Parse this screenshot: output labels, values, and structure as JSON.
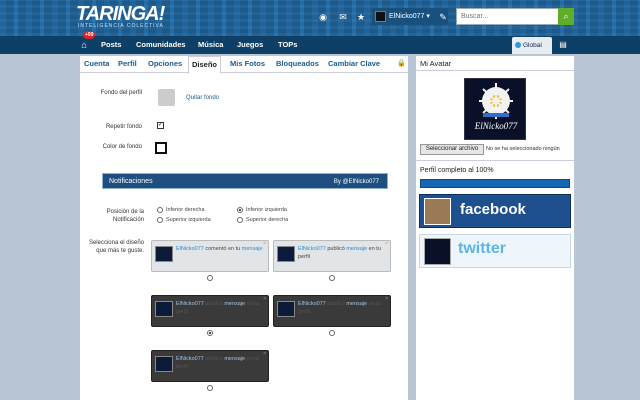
{
  "header": {
    "logo": "TARINGA!",
    "tagline": "INTELIGENCIA COLECTIVA",
    "username": "ElNicko077",
    "search_placeholder": "Buscar...",
    "icons": [
      "eye-icon",
      "mail-icon",
      "star-icon",
      "edit-icon"
    ]
  },
  "nav": {
    "badge": "+99",
    "items": [
      "Posts",
      "Comunidades",
      "Música",
      "Juegos",
      "TOPs"
    ],
    "global_label": "Global"
  },
  "tabs": [
    "Cuenta",
    "Perfil",
    "Opciones",
    "Diseño",
    "Mis Fotos",
    "Bloqueados",
    "Cambiar Clave"
  ],
  "active_tab": "Diseño",
  "design": {
    "bg_label": "Fondo del perfil",
    "remove_bg": "Quitar fondo",
    "repeat_label": "Repetir fondo",
    "repeat_checked": true,
    "color_label": "Color de fondo",
    "notif_bar_title": "Notificaciones",
    "notif_bar_by": "By @ElNicko077",
    "position_label": "Posición de la Notificación",
    "positions": [
      "Inferior derecha",
      "Inferior izquierda",
      "Superior izquierda",
      "Superior derecha"
    ],
    "selected_position": "Inferior izquierda",
    "style_label": "Selecciona el diseño que más te guste.",
    "note_user": "ElNicko077",
    "note_text_1": "comentó en tu",
    "note_link_1": "mensaje",
    "note_text_2": "publicó",
    "note_link_2": "mensaje",
    "note_text_3": "en tu perfil"
  },
  "sidebar": {
    "avatar_title": "Mi Avatar",
    "file_button": "Seleccionar archivo",
    "file_status": "No se ha seleccionado ningún",
    "progress_label": "Perfil completo al 100%",
    "progress": 1.0,
    "facebook": "facebook",
    "twitter": "twitter"
  }
}
